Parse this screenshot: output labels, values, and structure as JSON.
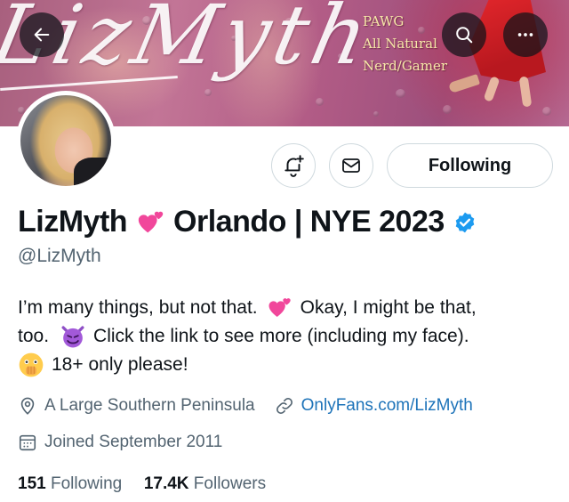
{
  "banner": {
    "logo_text": "LizMyth",
    "taglines": [
      "PAWG",
      "All Natural",
      "Nerd/Gamer"
    ]
  },
  "header_buttons": {
    "back_icon": "arrow-left-icon",
    "search_icon": "search-icon",
    "more_icon": "more-horizontal-icon"
  },
  "actions": {
    "notify_icon": "bell-plus-icon",
    "message_icon": "envelope-icon",
    "follow_label": "Following"
  },
  "profile": {
    "name_part1": "LizMyth",
    "name_part2": "Orlando | NYE 2023",
    "handle": "@LizMyth",
    "verified": true
  },
  "bio": {
    "line1_a": "I’m many things, but not that.",
    "line1_b": "Okay, I might be that,",
    "line2_a": "too.",
    "line2_b": "Click the link to see more (including my face).",
    "line3": "18+ only please!"
  },
  "meta": {
    "location": "A Large Southern Peninsula",
    "website": "OnlyFans.com/LizMyth",
    "joined": "Joined September 2011"
  },
  "stats": {
    "following_count": "151",
    "following_label": "Following",
    "followers_count": "17.4K",
    "followers_label": "Followers"
  },
  "colors": {
    "link": "#1d73b9",
    "verified": "#1d9bf0",
    "secondary_text": "#536471",
    "primary_text": "#0f1419"
  }
}
